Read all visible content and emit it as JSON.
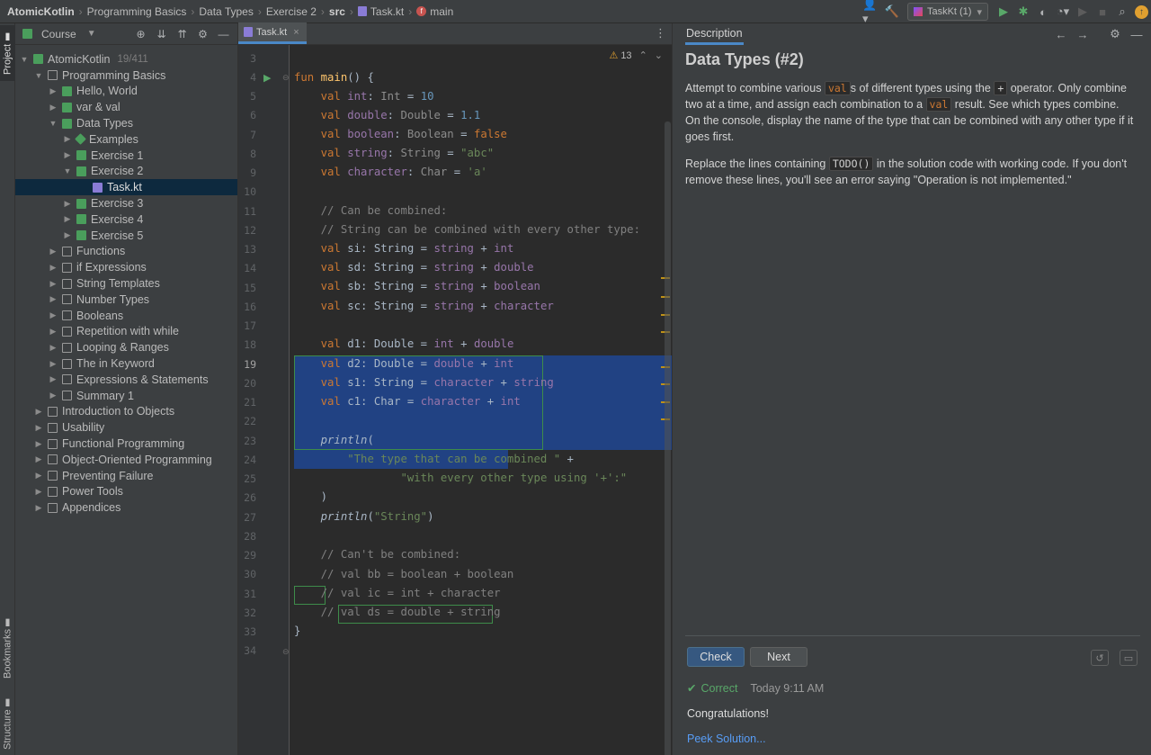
{
  "breadcrumbs": [
    "AtomicKotlin",
    "Programming Basics",
    "Data Types",
    "Exercise 2",
    "src",
    "Task.kt",
    "main"
  ],
  "toolbar": {
    "run_config": "TaskKt (1)"
  },
  "left_strip": {
    "project": "Project",
    "bookmarks": "Bookmarks",
    "structure": "Structure"
  },
  "project_panel": {
    "title": "Course",
    "root": {
      "label": "AtomicKotlin",
      "counter": "19/411"
    },
    "items": [
      {
        "label": "Programming Basics"
      },
      {
        "label": "Hello, World"
      },
      {
        "label": "var & val"
      },
      {
        "label": "Data Types"
      },
      {
        "label": "Examples"
      },
      {
        "label": "Exercise 1"
      },
      {
        "label": "Exercise 2"
      },
      {
        "label": "Task.kt"
      },
      {
        "label": "Exercise 3"
      },
      {
        "label": "Exercise 4"
      },
      {
        "label": "Exercise 5"
      },
      {
        "label": "Functions"
      },
      {
        "label": "if Expressions"
      },
      {
        "label": "String Templates"
      },
      {
        "label": "Number Types"
      },
      {
        "label": "Booleans"
      },
      {
        "label": "Repetition with while"
      },
      {
        "label": "Looping & Ranges"
      },
      {
        "label": "The in Keyword"
      },
      {
        "label": "Expressions & Statements"
      },
      {
        "label": "Summary 1"
      },
      {
        "label": "Introduction to Objects"
      },
      {
        "label": "Usability"
      },
      {
        "label": "Functional Programming"
      },
      {
        "label": "Object-Oriented Programming"
      },
      {
        "label": "Preventing Failure"
      },
      {
        "label": "Power Tools"
      },
      {
        "label": "Appendices"
      }
    ]
  },
  "editor": {
    "tab": "Task.kt",
    "warnings": "13",
    "line_numbers": [
      "3",
      "4",
      "5",
      "6",
      "7",
      "8",
      "9",
      "10",
      "11",
      "12",
      "13",
      "14",
      "15",
      "16",
      "17",
      "18",
      "19",
      "20",
      "21",
      "22",
      "23",
      "24",
      "25",
      "26",
      "27",
      "28",
      "29",
      "30",
      "31",
      "32",
      "33",
      "34"
    ]
  },
  "description": {
    "tab": "Description",
    "title": "Data Types (#2)",
    "p1": {
      "a": "Attempt to combine various ",
      "code1": "val",
      "b": "s of different types using the ",
      "code2": "+",
      "c": " operator. Only combine two at a time, and assign each combination to a ",
      "code3": "val",
      "d": " result. See which types combine. On the console, display the name of the type that can be combined with any other type if it goes first."
    },
    "p2": {
      "a": "Replace the lines containing ",
      "code1": "TODO()",
      "b": " in the solution code with working code. If you don't remove these lines, you'll see an error saying \"Operation is not implemented.\""
    },
    "check_button": "Check",
    "next_button": "Next",
    "status": "Correct",
    "timestamp": "Today 9:11 AM",
    "message": "Congratulations!",
    "peek_link": "Peek Solution..."
  }
}
